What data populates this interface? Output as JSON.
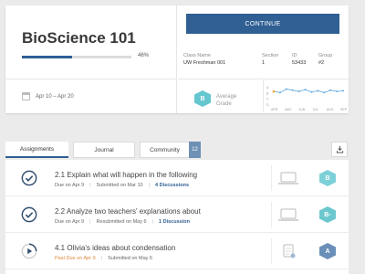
{
  "course": {
    "title": "BioScience 101",
    "progress_pct": 46,
    "progress_label": "46%",
    "date_range": "Apr 10 – Apr 20"
  },
  "continue_label": "CONTINUE",
  "info": {
    "class_name_label": "Class Name",
    "class_name": "UW Freshman 001",
    "section_label": "Section",
    "section": "1",
    "id_label": "ID",
    "id": "53433",
    "group_label": "Group",
    "group": "#2"
  },
  "average_grade": {
    "letter": "B",
    "label_line1": "Average",
    "label_line2": "Grade",
    "accent": "#64c6cf"
  },
  "chart_data": {
    "type": "line",
    "categories": [
      "APR",
      "MAY",
      "JUN",
      "JUL",
      "AUG",
      "SEP"
    ],
    "y_categories": [
      "A",
      "B",
      "C",
      "D"
    ],
    "values": [
      3.2,
      3.0,
      3.6,
      3.4,
      3.2,
      3.5,
      3.1,
      3.3,
      3.0,
      3.4,
      3.2,
      3.3
    ],
    "start_point_color": "#f0a53a",
    "line_color": "#6aaee0"
  },
  "tabs": [
    {
      "label": "Assignments"
    },
    {
      "label": "Journal"
    },
    {
      "label": "Community"
    }
  ],
  "community_count": "12",
  "assignments": [
    {
      "title": "2.1 Explain what will happen in the following",
      "due": "Due on Apr 9",
      "status": "Submitted on Mar 10",
      "discussions": "4 Discussions",
      "grade": "B",
      "icon": "check-circle-icon"
    },
    {
      "title": "2.2 Analyze two teachers' explanations about",
      "due": "Due on Apr 9",
      "status": "Resubmitted on May 6",
      "discussions": "1 Discussion",
      "grade": "B-",
      "icon": "check-circle-icon"
    },
    {
      "title": "4.1 Olivia's ideas about condensation",
      "due": "Past Due on Apr 9",
      "status": "Submitted on May 6",
      "discussions": "",
      "grade": "A",
      "icon": "in-progress-icon"
    }
  ],
  "colors": {
    "primary": "#2f5f93",
    "late": "#e08a3a"
  }
}
